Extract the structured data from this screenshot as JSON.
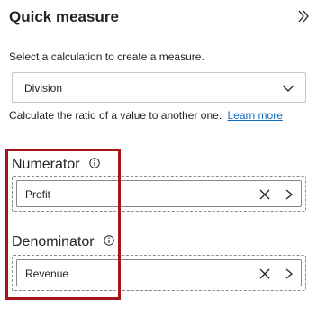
{
  "panel": {
    "title": "Quick measure",
    "collapse_icon": "double-chevron-right-icon"
  },
  "calculation": {
    "prompt": "Select a calculation to create a measure.",
    "selected": "Division",
    "description": "Calculate the ratio of a value to another one.",
    "learn_more": "Learn more"
  },
  "numerator": {
    "label": "Numerator",
    "field": "Profit"
  },
  "denominator": {
    "label": "Denominator",
    "field": "Revenue"
  },
  "colors": {
    "link": "#0f6cbd",
    "highlight_border": "#a4161a",
    "text": "#252423"
  }
}
